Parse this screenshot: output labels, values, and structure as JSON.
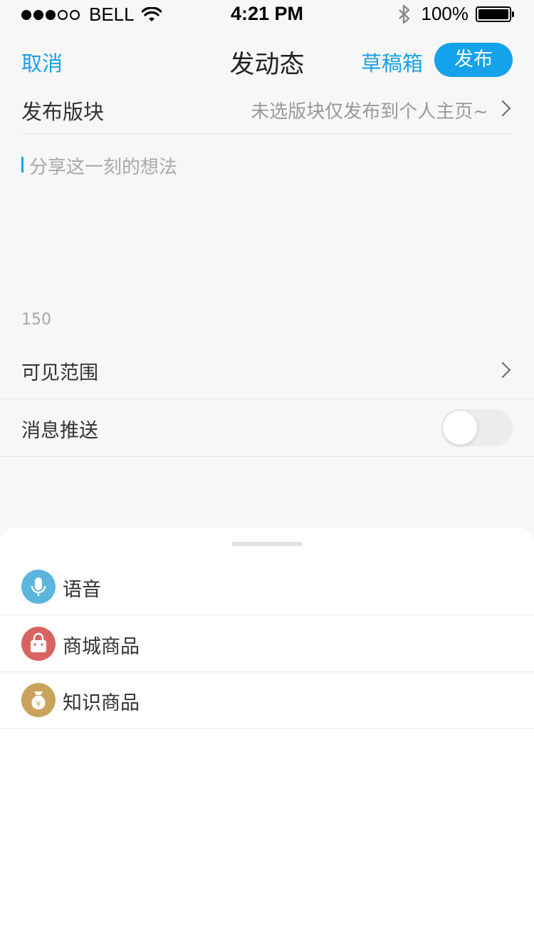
{
  "status_bar": {
    "carrier": "BELL",
    "time": "4:21 PM",
    "battery": "100%",
    "battery_level": 1.0
  },
  "nav": {
    "cancel": "取消",
    "title": "发动态",
    "drafts": "草稿箱",
    "publish": "发布"
  },
  "section": {
    "label": "发布版块",
    "value": "未选版块仅发布到个人主页~"
  },
  "composer": {
    "placeholder": "分享这一刻的想法",
    "char_limit": "150"
  },
  "options": {
    "visibility": "可见范围",
    "push": "消息推送",
    "push_enabled": false
  },
  "tools": [
    {
      "label": "语音",
      "icon": "microphone-icon",
      "color": "#5bb5df"
    },
    {
      "label": "商城商品",
      "icon": "shopping-bag-icon",
      "color": "#d9645f"
    },
    {
      "label": "知识商品",
      "icon": "money-bag-icon",
      "color": "#c9a35d"
    }
  ],
  "colors": {
    "accent": "#14a3ea",
    "background": "#f7f7f7"
  }
}
